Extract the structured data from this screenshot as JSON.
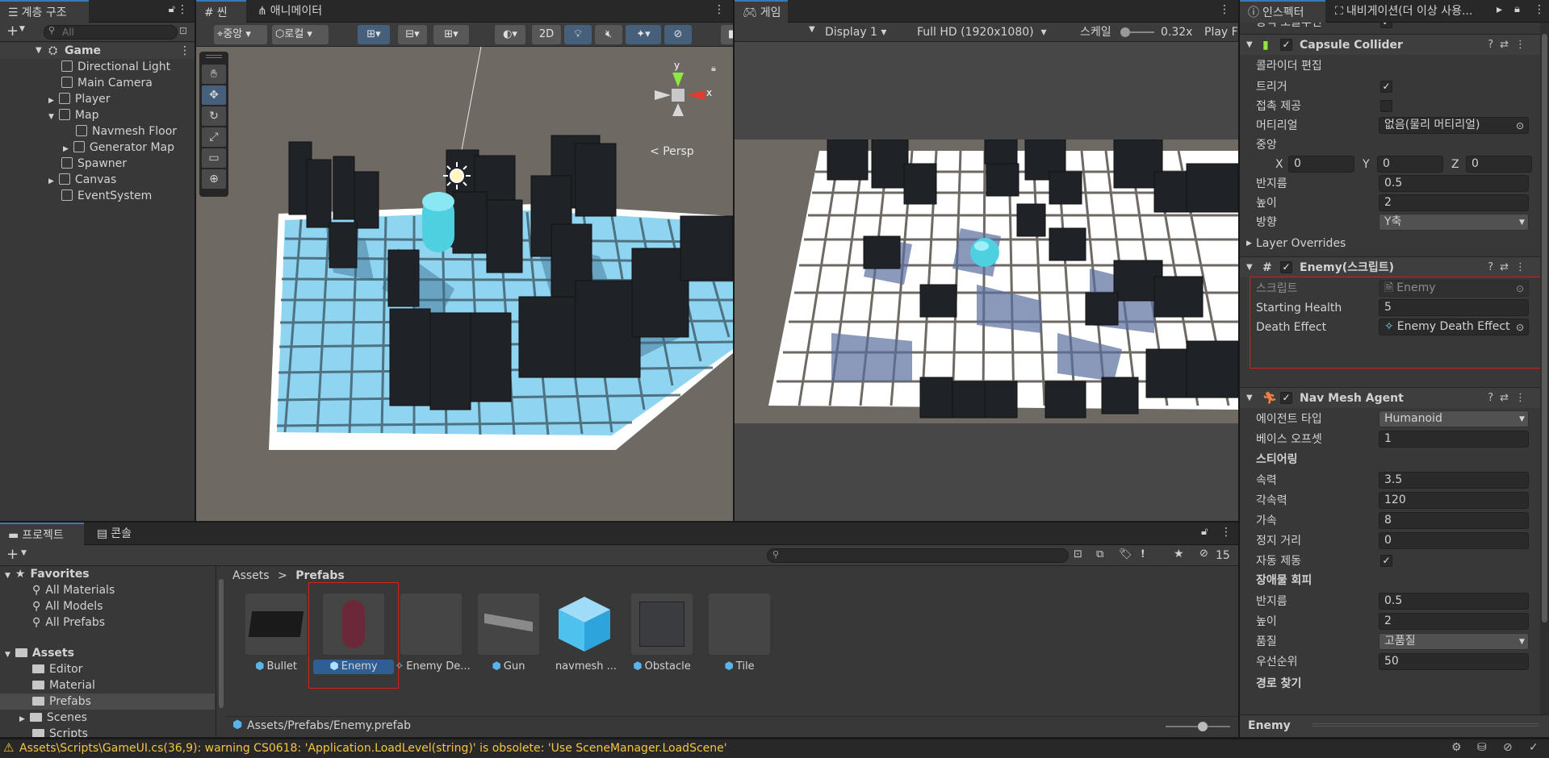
{
  "hierarchy": {
    "tab": "계층 구조",
    "search_placeholder": "All",
    "add_label": "+",
    "scene": "Game",
    "items": [
      {
        "label": "Directional Light"
      },
      {
        "label": "Main Camera"
      },
      {
        "label": "Player"
      },
      {
        "label": "Map"
      },
      {
        "label": "Navmesh Floor"
      },
      {
        "label": "Generator Map"
      },
      {
        "label": "Spawner"
      },
      {
        "label": "Canvas"
      },
      {
        "label": "EventSystem"
      }
    ]
  },
  "scene": {
    "tab": "씬",
    "animator_tab": "애니메이터",
    "pivot": "중앙",
    "space": "로컬",
    "mode2d": "2D",
    "persp": "Persp",
    "gizmo_y": "y",
    "gizmo_x": "x"
  },
  "game": {
    "tab": "게임",
    "display": "Display 1",
    "resolution": "Full HD (1920x1080)",
    "scale_label": "스케일",
    "scale_value": "0.32x",
    "play_focused": "Play F"
  },
  "inspector": {
    "tab": "인스펙터",
    "nav_tab": "내비게이션(더 이상 사용...",
    "top_cut_label": "동적 오클루전",
    "capsule": {
      "title": "Capsule Collider",
      "edit_label": "콜라이더 편집",
      "trigger_label": "트리거",
      "contact_label": "접촉 제공",
      "material_label": "머티리얼",
      "material_value": "없음(물리 머티리얼)",
      "center_label": "중앙",
      "cx_label": "X",
      "cx": "0",
      "cy_label": "Y",
      "cy": "0",
      "cz_label": "Z",
      "cz": "0",
      "radius_label": "반지름",
      "radius": "0.5",
      "height_label": "높이",
      "height": "2",
      "direction_label": "방향",
      "direction": "Y축",
      "layer_overrides": "Layer Overrides"
    },
    "enemy": {
      "title": "Enemy(스크립트)",
      "script_label": "스크립트",
      "script_value": "Enemy",
      "health_label": "Starting Health",
      "health": "5",
      "death_label": "Death Effect",
      "death_value": "Enemy Death Effect"
    },
    "navmesh": {
      "title": "Nav Mesh Agent",
      "agent_type_label": "에이전트 타입",
      "agent_type": "Humanoid",
      "base_offset_label": "베이스 오프셋",
      "base_offset": "1",
      "steering_header": "스티어링",
      "speed_label": "속력",
      "speed": "3.5",
      "angular_label": "각속력",
      "angular": "120",
      "accel_label": "가속",
      "accel": "8",
      "stop_label": "정지 거리",
      "stop": "0",
      "auto_brake_label": "자동 제동",
      "avoid_header": "장애물 회피",
      "avoid_radius_label": "반지름",
      "avoid_radius": "0.5",
      "avoid_height_label": "높이",
      "avoid_height": "2",
      "quality_label": "품질",
      "quality": "고품질",
      "priority_label": "우선순위",
      "priority": "50",
      "path_header": "경로 찾기"
    },
    "footer": "Enemy"
  },
  "project": {
    "tab": "프로젝트",
    "console_tab": "콘솔",
    "count": "15",
    "favorites_label": "Favorites",
    "favorites": [
      "All Materials",
      "All Models",
      "All Prefabs"
    ],
    "assets_label": "Assets",
    "folders": [
      "Editor",
      "Material",
      "Prefabs",
      "Scenes",
      "Scripts"
    ],
    "breadcrumb_root": "Assets",
    "breadcrumb_current": "Prefabs",
    "assets": [
      {
        "label": "Bullet"
      },
      {
        "label": "Enemy"
      },
      {
        "label": "Enemy De..."
      },
      {
        "label": "Gun"
      },
      {
        "label": "navmesh ..."
      },
      {
        "label": "Obstacle"
      },
      {
        "label": "Tile"
      }
    ],
    "path": "Assets/Prefabs/Enemy.prefab"
  },
  "status": {
    "message": "Assets\\Scripts\\GameUI.cs(36,9): warning CS0618: 'Application.LoadLevel(string)' is obsolete: 'Use SceneManager.LoadScene'"
  },
  "colors": {
    "accent": "#3a79bb",
    "highlight": "#d02020",
    "warning": "#f4c542",
    "panel": "#383838"
  }
}
